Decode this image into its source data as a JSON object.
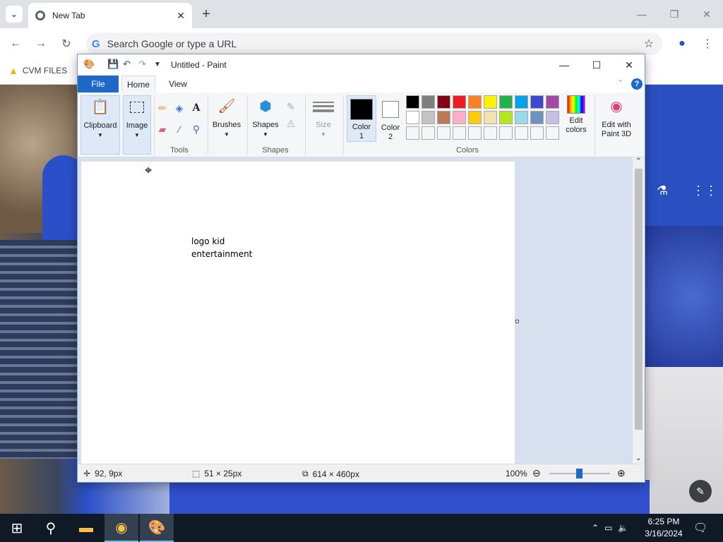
{
  "browser": {
    "tab_title": "New Tab",
    "omnibox_placeholder": "Search Google or type a URL",
    "bookmark": "CVM FILES",
    "new_tab_symbol": "+"
  },
  "paint": {
    "title": "Untitled - Paint",
    "tabs": {
      "file": "File",
      "home": "Home",
      "view": "View"
    },
    "groups": {
      "tools": "Tools",
      "shapes": "Shapes",
      "colors": "Colors"
    },
    "buttons": {
      "clipboard": "Clipboard",
      "image": "Image",
      "brushes": "Brushes",
      "shapes": "Shapes",
      "size": "Size",
      "color1": "Color 1",
      "color1_line1": "Color",
      "color1_line2": "1",
      "color2_line1": "Color",
      "color2_line2": "2",
      "edit_colors_line1": "Edit",
      "edit_colors_line2": "colors",
      "paint3d_line1": "Edit with",
      "paint3d_line2": "Paint 3D"
    },
    "palette_row1": [
      "#000000",
      "#7f7f7f",
      "#880015",
      "#ed1c24",
      "#ff7f27",
      "#fff200",
      "#22b14c",
      "#00a2e8",
      "#3f48cc",
      "#a349a4"
    ],
    "palette_row2": [
      "#ffffff",
      "#c3c3c3",
      "#b97a57",
      "#ffaec9",
      "#ffc90e",
      "#efe4b0",
      "#b5e61d",
      "#99d9ea",
      "#7092be",
      "#c8bfe7"
    ],
    "canvas_text_line1": "logo kid",
    "canvas_text_line2": "entertainment",
    "status": {
      "cursor_pos": "92, 9px",
      "selection_size": "51 × 25px",
      "image_size": "614 × 460px",
      "zoom": "100%"
    }
  },
  "taskbar": {
    "time": "6:25 PM",
    "date": "3/16/2024"
  }
}
